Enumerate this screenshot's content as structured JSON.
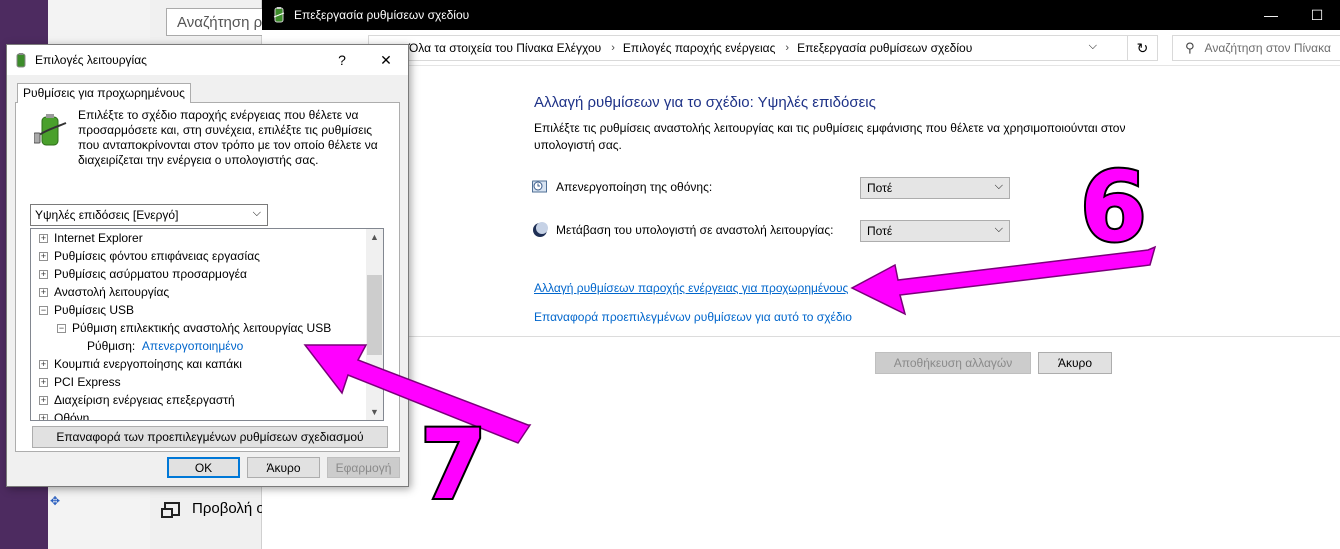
{
  "background": {
    "search_placeholder": "Αναζήτηση ρ",
    "display_label": "Προβολή ο"
  },
  "window": {
    "title": "Επεξεργασία ρυθμίσεων σχεδίου",
    "controls": {
      "minimize": "—",
      "maximize": "☐"
    },
    "breadcrumb": [
      "Όλα τα στοιχεία του Πίνακα Ελέγχου",
      "Επιλογές παροχής ενέργειας",
      "Επεξεργασία ρυθμίσεων σχεδίου"
    ],
    "search_placeholder": "Αναζήτηση στον Πίνακα",
    "heading": "Αλλαγή ρυθμίσεων για το σχέδιο: Υψηλές επιδόσεις",
    "description": "Επιλέξτε τις ρυθμίσεις αναστολής λειτουργίας και τις ρυθμίσεις εμφάνισης που θέλετε να χρησιμοποιούνται στον υπολογιστή σας.",
    "settings": [
      {
        "label": "Απενεργοποίηση της οθόνης:",
        "value": "Ποτέ"
      },
      {
        "label": "Μετάβαση του υπολογιστή σε αναστολή λειτουργίας:",
        "value": "Ποτέ"
      }
    ],
    "advanced_link": "Αλλαγή ρυθμίσεων παροχής ενέργειας για προχωρημένους",
    "restore_link": "Επαναφορά προεπιλεγμένων ρυθμίσεων για αυτό το σχέδιο",
    "save_button": "Αποθήκευση αλλαγών",
    "cancel_button": "Άκυρο"
  },
  "dialog": {
    "title": "Επιλογές λειτουργίας",
    "help": "?",
    "close": "✕",
    "tab": "Ρυθμίσεις για προχωρημένους",
    "description": "Επιλέξτε το σχέδιο παροχής ενέργειας που θέλετε να προσαρμόσετε και, στη συνέχεια, επιλέξτε τις ρυθμίσεις που ανταποκρίνονται στον τρόπο με τον οποίο θέλετε να διαχειρίζεται την ενέργεια ο υπολογιστής σας.",
    "plan": "Υψηλές επιδόσεις [Ενεργό]",
    "tree": [
      {
        "sign": "+",
        "label": "Internet Explorer",
        "level": 0
      },
      {
        "sign": "+",
        "label": "Ρυθμίσεις φόντου επιφάνειας εργασίας",
        "level": 0
      },
      {
        "sign": "+",
        "label": "Ρυθμίσεις ασύρματου προσαρμογέα",
        "level": 0
      },
      {
        "sign": "+",
        "label": "Αναστολή λειτουργίας",
        "level": 0
      },
      {
        "sign": "−",
        "label": "Ρυθμίσεις USB",
        "level": 0
      },
      {
        "sign": "−",
        "label": "Ρύθμιση επιλεκτικής αναστολής λειτουργίας USB",
        "level": 1
      },
      {
        "sign": "",
        "label": "Ρύθμιση:",
        "value": "Απενεργοποιημένο",
        "level": 2
      },
      {
        "sign": "+",
        "label": "Κουμπιά ενεργοποίησης και καπάκι",
        "level": 0
      },
      {
        "sign": "+",
        "label": "PCI Express",
        "level": 0
      },
      {
        "sign": "+",
        "label": "Διαχείριση ενέργειας επεξεργαστή",
        "level": 0
      },
      {
        "sign": "+",
        "label": "Οθόνη",
        "level": 0
      }
    ],
    "restore_button": "Επαναφορά των προεπιλεγμένων ρυθμίσεων σχεδιασμού",
    "ok": "OK",
    "cancel": "Άκυρο",
    "apply": "Εφαρμογή"
  },
  "annotations": {
    "step6": "6",
    "step7": "7",
    "color": "#ff00ff"
  }
}
